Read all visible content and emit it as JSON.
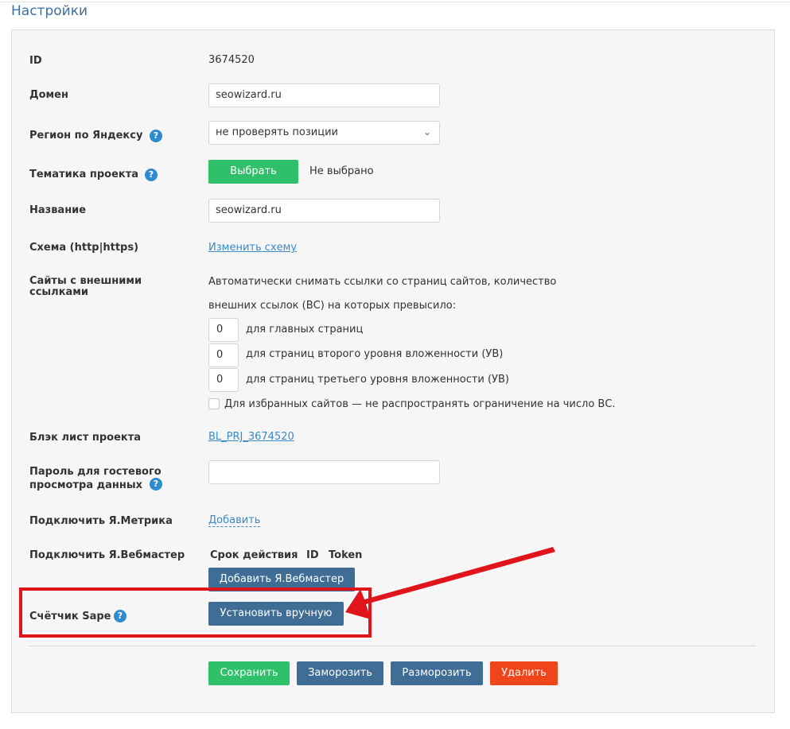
{
  "page_title": "Настройки",
  "fields": {
    "id": {
      "label": "ID",
      "value": "3674520"
    },
    "domain": {
      "label": "Домен",
      "value": "seowizard.ru"
    },
    "region": {
      "label": "Регион по Яндексу",
      "value": "не проверять позиции"
    },
    "theme": {
      "label": "Тематика проекта",
      "button": "Выбрать",
      "status": "Не выбрано"
    },
    "name": {
      "label": "Название",
      "value": "seowizard.ru"
    },
    "scheme": {
      "label": "Схема (http|https)",
      "link": "Изменить схему"
    },
    "external": {
      "label_line1": "Сайты с внешними",
      "label_line2": "ссылками",
      "desc_line1": "Автоматически снимать ссылки со страниц сайтов, количество",
      "desc_line2": "внешних ссылок (ВС) на которых превысило:",
      "rows": [
        {
          "value": "0",
          "label": "для главных страниц"
        },
        {
          "value": "0",
          "label": "для страниц второго уровня вложенности (УВ)"
        },
        {
          "value": "0",
          "label": "для страниц третьего уровня вложенности (УВ)"
        }
      ],
      "checkbox_label": "Для избранных сайтов — не распространять ограничение на число ВС."
    },
    "blacklist": {
      "label": "Блэк лист проекта",
      "link": "BL_PRJ_3674520"
    },
    "guest_password": {
      "label_line1": "Пароль для гостевого",
      "label_line2": "просмотра данных",
      "value": ""
    },
    "metrika": {
      "label": "Подключить Я.Метрика",
      "link": "Добавить"
    },
    "webmaster": {
      "label": "Подключить Я.Вебмастер",
      "col_term": "Срок действия",
      "col_id": "ID",
      "col_token": "Token",
      "button": "Добавить Я.Вебмастер"
    },
    "sape": {
      "label": "Счётчик Sape",
      "button": "Установить вручную"
    }
  },
  "help_glyph": "?",
  "actions": {
    "save": "Сохранить",
    "freeze": "Заморозить",
    "unfreeze": "Разморозить",
    "delete": "Удалить"
  },
  "colors": {
    "title": "#3d6fa0",
    "green": "#2fc06a",
    "blue": "#3f6d95",
    "red": "#f0441a",
    "highlight": "#e0141b",
    "link": "#3a8bc5"
  },
  "icons": {
    "region_select": "chevron-down-icon",
    "annotation": "red-arrow-icon"
  }
}
